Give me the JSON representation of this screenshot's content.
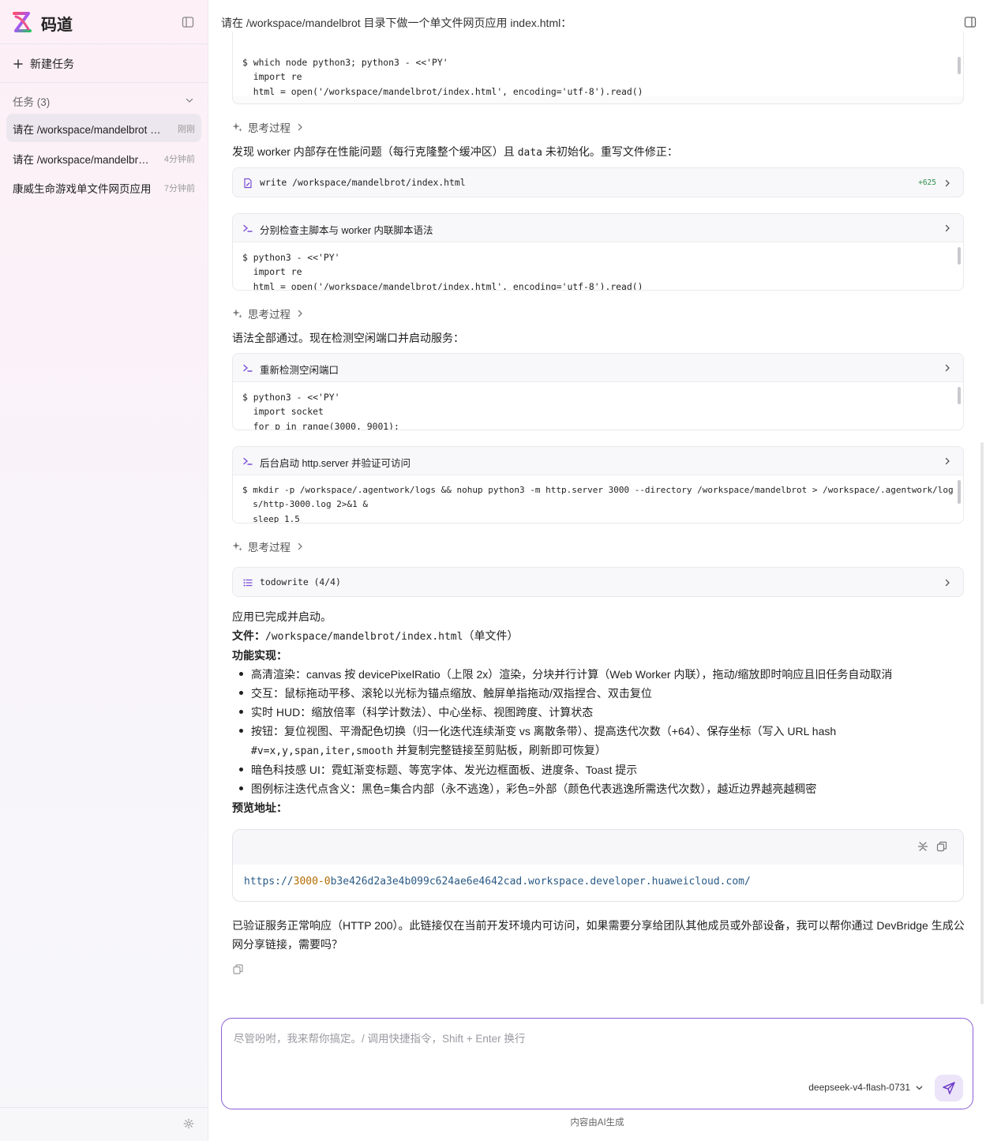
{
  "sidebar": {
    "brand": "码道",
    "new_task": "新建任务",
    "tasks_label": "任务 (3)",
    "tasks": [
      {
        "title": "请在 /workspace/mandelbrot 目录下做一个单文件网页应用 index.html",
        "time": "刚刚",
        "active": true
      },
      {
        "title": "请在 /workspace/mandelbrot 目录下做一个单文件网页应用",
        "time": "4分钟前",
        "active": false
      },
      {
        "title": "康威生命游戏单文件网页应用",
        "time": "7分钟前",
        "active": false
      }
    ]
  },
  "header": {
    "title": "请在 /workspace/mandelbrot 目录下做一个单文件网页应用 index.html："
  },
  "blocks": {
    "card0_code": "$ which node python3; python3 - <<'PY'\n  import re\n  html = open('/workspace/mandelbrot/index.html', encoding='utf-8').read()",
    "think_label": "思考过程",
    "para1_prefix": "发现 worker 内部存在性能问题（每行克隆整个缓冲区）且 ",
    "para1_mono": "data",
    "para1_suffix": " 未初始化。重写文件修正：",
    "write_label": "write /workspace/mandelbrot/index.html",
    "write_badge": "+625",
    "card2_label": "分别检查主脚本与 worker 内联脚本语法",
    "card2_code": "$ python3 - <<'PY'\n  import re\n  html = open('/workspace/mandelbrot/index.html', encoding='utf-8').read()",
    "para2": "语法全部通过。现在检测空闲端口并启动服务：",
    "card3_label": "重新检测空闲端口",
    "card3_code": "$ python3 - <<'PY'\n  import socket\n  for p in range(3000, 9001):",
    "card4_label": "后台启动 http.server 并验证可访问",
    "card4_code": "$ mkdir -p /workspace/.agentwork/logs && nohup python3 -m http.server 3000 --directory /workspace/mandelbrot > /workspace/.agentwork/log\n  s/http-3000.log 2>&1 &\n  sleep 1.5",
    "todo_label": "todowrite (4/4)"
  },
  "summary": {
    "done": "应用已完成并启动。",
    "file_label": "文件",
    "file_path": "/workspace/mandelbrot/index.html",
    "file_suffix": "（单文件）",
    "features_label": "功能实现",
    "bullets": [
      "高清渲染：canvas 按 devicePixelRatio（上限 2x）渲染，分块并行计算（Web Worker 内联），拖动/缩放即时响应且旧任务自动取消",
      "交互：鼠标拖动平移、滚轮以光标为锚点缩放、触屏单指拖动/双指捏合、双击复位",
      "实时 HUD：缩放倍率（科学计数法）、中心坐标、视图跨度、计算状态",
      "按钮：复位视图、平滑配色切换（归一化迭代连续渐变 vs 离散条带）、提高迭代次数（+64）、保存坐标（写入 URL hash",
      "暗色科技感 UI：霓虹渐变标题、等宽字体、发光边框面板、进度条、Toast 提示",
      "图例标注迭代点含义：黑色=集合内部（永不逃逸），彩色=外部（颜色代表逃逸所需迭代次数），越近边界越亮越稠密"
    ],
    "bullet4_mono": "#v=x,y,span,iter,smooth",
    "bullet4_tail": " 并复制完整链接至剪贴板，刷新即可恢复）",
    "preview_label": "预览地址",
    "url_a": "https://",
    "url_b": "3000-0",
    "url_c": "b3e426d2a3e4b099c624ae6e4642cad.workspace.developer.huaweicloud.com/",
    "final": "已验证服务正常响应（HTTP 200）。此链接仅在当前开发环境内可访问，如果需要分享给团队其他成员或外部设备，我可以帮你通过 DevBridge 生成公网分享链接，需要吗？"
  },
  "composer": {
    "placeholder": "尽管吩咐，我来帮你搞定。/ 调用快捷指令，Shift + Enter 换行",
    "model": "deepseek-v4-flash-0731",
    "disclaimer": "内容由AI生成"
  },
  "colors": {
    "accent": "#8b5ed6",
    "badge_green": "#2d8f4e"
  }
}
